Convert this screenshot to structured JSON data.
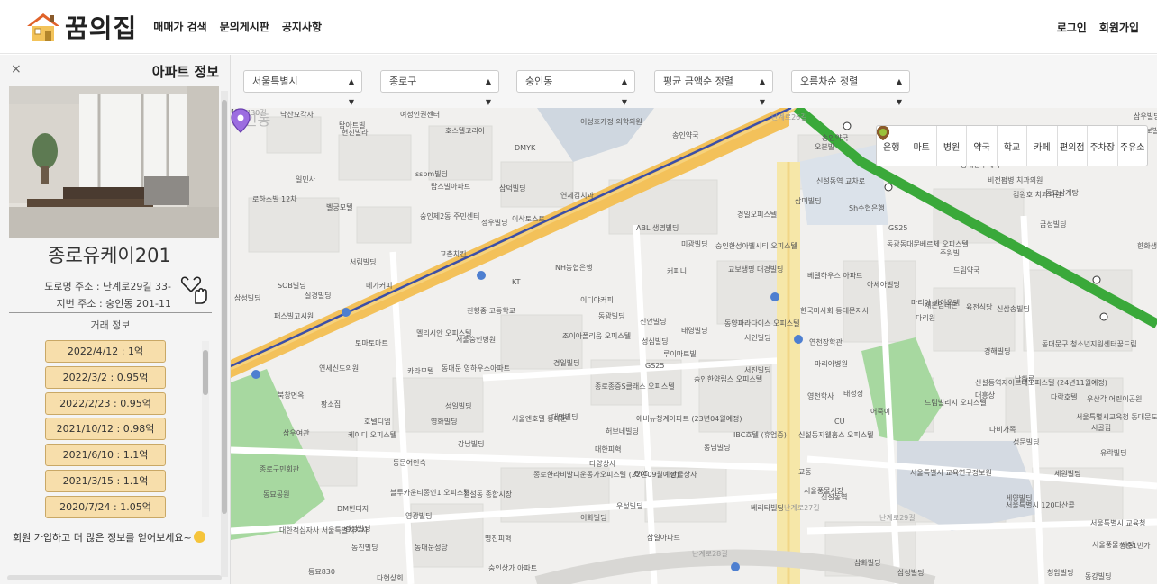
{
  "header": {
    "logo_text": "꿈의집",
    "nav": [
      "매매가 검색",
      "문의게시판",
      "공지사항"
    ],
    "login": "로그인",
    "signup": "회원가입"
  },
  "sidebar": {
    "close": "×",
    "title": "아파트 정보",
    "apt_name": "종로유케이201",
    "road_address": "도로명 주소 : 난계로29길 33-",
    "lot_address": "지번 주소 : 숭인동 201-11",
    "deal_heading": "거래 정보",
    "deals": [
      "2022/4/12 : 1억",
      "2022/3/2 : 0.95억",
      "2022/2/23 : 0.95억",
      "2021/10/12 : 0.98억",
      "2021/6/10 : 1.1억",
      "2021/3/15 : 1.1억",
      "2020/7/24 : 1.05억"
    ],
    "join_message": "회원 가입하고 더 많은 정보를 얻어보세요~"
  },
  "filters": {
    "city": "서울특별시",
    "district": "종로구",
    "dong": "숭인동",
    "sort_price": "평균 금액순 정렬",
    "sort_order": "오름차순 정렬"
  },
  "categories": [
    "은행",
    "마트",
    "병원",
    "약국",
    "학교",
    "카페",
    "편의점",
    "주차장",
    "주유소"
  ],
  "map_labels": [
    {
      "t": "낙산묘각사",
      "c": "poi"
    },
    {
      "t": "여성인권센터",
      "c": "poi"
    },
    {
      "t": "탑아트빌",
      "c": "poi"
    },
    {
      "t": "현진빌라",
      "c": "poi"
    },
    {
      "t": "일민사",
      "c": "poi"
    },
    {
      "t": "로하스빌 12차",
      "c": "poi"
    },
    {
      "t": "이성호가정 의학의원",
      "c": "poi"
    },
    {
      "t": "송인약국",
      "c": "poi"
    },
    {
      "t": "호스텔코리아",
      "c": "poi"
    },
    {
      "t": "DMYK",
      "c": "poi"
    },
    {
      "t": "sspm빌딩",
      "c": "poi"
    },
    {
      "t": "탑스빌아파트",
      "c": "poi"
    },
    {
      "t": "삼덕빌딩",
      "c": "poi"
    },
    {
      "t": "연세김치과",
      "c": "poi"
    },
    {
      "t": "벨궁모텔",
      "c": "poi"
    },
    {
      "t": "숭인제2동 주민센터",
      "c": "poi"
    },
    {
      "t": "정우빌딩",
      "c": "poi"
    },
    {
      "t": "이삭토스트",
      "c": "poi"
    },
    {
      "t": "ABL 생명빌딩",
      "c": "poi"
    },
    {
      "t": "미광빌딩",
      "c": "poi"
    },
    {
      "t": "경일오피스텔",
      "c": "poi"
    },
    {
      "t": "숭인한성아벨시티 오피스텔",
      "c": "poi"
    },
    {
      "t": "교보생명 대경빌딩",
      "c": "poi"
    },
    {
      "t": "서림빌딩",
      "c": "poi"
    },
    {
      "t": "교촌치킨",
      "c": "poi"
    },
    {
      "t": "NH농협은행",
      "c": "poi"
    },
    {
      "t": "커피니",
      "c": "poi"
    },
    {
      "t": "메가커피",
      "c": "poi"
    },
    {
      "t": "SOB빌딩",
      "c": "poi"
    },
    {
      "t": "삼성빌딩",
      "c": "poi"
    },
    {
      "t": "실경빌딩",
      "c": "poi"
    },
    {
      "t": "패스빌고시원",
      "c": "poi"
    },
    {
      "t": "KT",
      "c": "poi"
    },
    {
      "t": "이디야커피",
      "c": "poi"
    },
    {
      "t": "친형중 고등학교",
      "c": "poi"
    },
    {
      "t": "동광빌딩",
      "c": "poi"
    },
    {
      "t": "신안빌딩",
      "c": "poi"
    },
    {
      "t": "태영빌딩",
      "c": "poi"
    },
    {
      "t": "동양파라다이스 오피스텔",
      "c": "poi"
    },
    {
      "t": "멜리시안 오피스텔",
      "c": "poi"
    },
    {
      "t": "서울숭인병원",
      "c": "poi"
    },
    {
      "t": "토마토마트",
      "c": "poi"
    },
    {
      "t": "조이아폴리움 오피스텔",
      "c": "poi"
    },
    {
      "t": "성심빌딩",
      "c": "poi"
    },
    {
      "t": "루이마트빌",
      "c": "poi"
    },
    {
      "t": "GS25",
      "c": "poi"
    },
    {
      "t": "경일빌딩",
      "c": "poi"
    },
    {
      "t": "서인빌딩",
      "c": "poi"
    },
    {
      "t": "서진빌딩",
      "c": "poi"
    },
    {
      "t": "연세신도의원",
      "c": "poi"
    },
    {
      "t": "카라모텔",
      "c": "poi"
    },
    {
      "t": "동대문 영하우스아파트",
      "c": "poi"
    },
    {
      "t": "숭인한양립스 오피스텔",
      "c": "poi"
    },
    {
      "t": "종로종증S클래스 오피스텔",
      "c": "poi"
    },
    {
      "t": "북창면옥",
      "c": "poi"
    },
    {
      "t": "황소집",
      "c": "poi"
    },
    {
      "t": "성일빌딩",
      "c": "poi"
    },
    {
      "t": "호텔디엠",
      "c": "poi"
    },
    {
      "t": "영화빌딩",
      "c": "poi"
    },
    {
      "t": "서울엔호텔 동대문",
      "c": "poi"
    },
    {
      "t": "대명빌딩",
      "c": "poi"
    },
    {
      "t": "에비뉴청계아파트 (23년04월예정)",
      "c": "poi"
    },
    {
      "t": "허브네빌딩",
      "c": "poi"
    },
    {
      "t": "삼우여관",
      "c": "poi"
    },
    {
      "t": "케이디 오피스텔",
      "c": "poi"
    },
    {
      "t": "강남빌딩",
      "c": "poi"
    },
    {
      "t": "대한피혁",
      "c": "poi"
    },
    {
      "t": "IBC호텔 (휴업중)",
      "c": "poi"
    },
    {
      "t": "신설동지웰홈스 오피스텔",
      "c": "poi"
    },
    {
      "t": "동문여인숙",
      "c": "poi"
    },
    {
      "t": "다양상사",
      "c": "poi"
    },
    {
      "t": "종로구민회관",
      "c": "poi"
    },
    {
      "t": "만물상사",
      "c": "poi"
    },
    {
      "t": "종로한라비발디운동가오피스텔 (22년09월예정)",
      "c": "poi"
    },
    {
      "t": "BYC",
      "c": "poi"
    },
    {
      "t": "동묘공원",
      "c": "poi"
    },
    {
      "t": "블루카운티종인1 오피스텔",
      "c": "poi"
    },
    {
      "t": "신설동 종합시장",
      "c": "poi"
    },
    {
      "t": "우성빌딩",
      "c": "poi"
    },
    {
      "t": "DM빈티지",
      "c": "poi"
    },
    {
      "t": "영광빌딩",
      "c": "poi"
    },
    {
      "t": "이화빌딩",
      "c": "poi"
    },
    {
      "t": "베리타빌딩",
      "c": "poi"
    },
    {
      "t": "대한적십자사 서울특별시지사",
      "c": "poi"
    },
    {
      "t": "경성빌딩",
      "c": "poi"
    },
    {
      "t": "명진피혁",
      "c": "poi"
    },
    {
      "t": "동진빌딩",
      "c": "poi"
    },
    {
      "t": "동대문성당",
      "c": "poi"
    },
    {
      "t": "삼일아파트",
      "c": "poi"
    },
    {
      "t": "동묘830",
      "c": "poi"
    },
    {
      "t": "다현상회",
      "c": "poi"
    },
    {
      "t": "숭인상가 아파트",
      "c": "poi"
    },
    {
      "t": "송인약국",
      "c": "poi"
    },
    {
      "t": "오븐빌",
      "c": "poi"
    },
    {
      "t": "신설동역 교차로",
      "c": "poi"
    },
    {
      "t": "삼미빌딩",
      "c": "poi"
    },
    {
      "t": "Sh수협은행",
      "c": "poi"
    },
    {
      "t": "동대문우체국",
      "c": "poi"
    },
    {
      "t": "비전펌병 치과의원",
      "c": "poi"
    },
    {
      "t": "김원호 치과의원",
      "c": "poi"
    },
    {
      "t": "동묘삼계탕",
      "c": "poi"
    },
    {
      "t": "금성빌딩",
      "c": "poi"
    },
    {
      "t": "한화생명보험 신설동지점",
      "c": "poi"
    },
    {
      "t": "GS25",
      "c": "poi"
    },
    {
      "t": "동광동대문베르체 오피스텔",
      "c": "poi"
    },
    {
      "t": "주원빌",
      "c": "poi"
    },
    {
      "t": "드림약국",
      "c": "poi"
    },
    {
      "t": "베델하우스 아파트",
      "c": "poi"
    },
    {
      "t": "아세아빌딩",
      "c": "poi"
    },
    {
      "t": "마리아 바이오텍",
      "c": "poi"
    },
    {
      "t": "한국마사회 동대문지사",
      "c": "poi"
    },
    {
      "t": "세본임레본",
      "c": "poi"
    },
    {
      "t": "육전식당",
      "c": "poi"
    },
    {
      "t": "신삼송빌딩",
      "c": "poi"
    },
    {
      "t": "다리원",
      "c": "poi"
    },
    {
      "t": "연천장학관",
      "c": "poi"
    },
    {
      "t": "마리아병원",
      "c": "poi"
    },
    {
      "t": "동대문구 청소년지원센터꿈드림",
      "c": "poi"
    },
    {
      "t": "경해빌딩",
      "c": "poi"
    },
    {
      "t": "남화루",
      "c": "poi"
    },
    {
      "t": "신설동역자이르네오피스텔 (24년11월예정)",
      "c": "poi"
    },
    {
      "t": "대흥상",
      "c": "poi"
    },
    {
      "t": "태성정",
      "c": "poi"
    },
    {
      "t": "영천학사",
      "c": "poi"
    },
    {
      "t": "CU",
      "c": "poi"
    },
    {
      "t": "어죽이",
      "c": "poi"
    },
    {
      "t": "드림빌리지 오피스텔",
      "c": "poi"
    },
    {
      "t": "다락호텔",
      "c": "poi"
    },
    {
      "t": "우산각 어린이공원",
      "c": "poi"
    },
    {
      "t": "서울특별시교육청 동대문도서관",
      "c": "poi"
    },
    {
      "t": "시골집",
      "c": "poi"
    },
    {
      "t": "다비가족",
      "c": "poi"
    },
    {
      "t": "성문빌딩",
      "c": "poi"
    },
    {
      "t": "유락빌딩",
      "c": "poi"
    },
    {
      "t": "서울풍물시장",
      "c": "poi"
    },
    {
      "t": "서울특별시 교육연구정보원",
      "c": "poi"
    },
    {
      "t": "세원빌딩",
      "c": "poi"
    },
    {
      "t": "세양빌딩",
      "c": "poi"
    },
    {
      "t": "서울특별시 120다산콜",
      "c": "poi"
    },
    {
      "t": "서울특별시 교육청",
      "c": "poi"
    },
    {
      "t": "서울풍물 시장",
      "c": "poi"
    },
    {
      "t": "청춘1번가",
      "c": "poi"
    },
    {
      "t": "삼화빌딩",
      "c": "poi"
    },
    {
      "t": "삼성빌딩",
      "c": "poi"
    },
    {
      "t": "청암빌딩",
      "c": "poi"
    },
    {
      "t": "동강빌딩",
      "c": "poi"
    },
    {
      "t": "삼우빌딩",
      "c": "poi"
    },
    {
      "t": "동보빌딩",
      "c": "poi"
    },
    {
      "t": "동님빌딩",
      "c": "poi"
    },
    {
      "t": "교동",
      "c": "poi"
    },
    {
      "t": "신설동역",
      "c": "poi"
    },
    {
      "t": "난계로27길",
      "c": "road"
    },
    {
      "t": "난계로29길",
      "c": "road"
    },
    {
      "t": "난계로26길",
      "c": "road"
    },
    {
      "t": "난계로28길",
      "c": "road"
    },
    {
      "t": "난계로30길",
      "c": "road"
    },
    {
      "t": "난계로",
      "c": "road"
    },
    {
      "t": "숭인동",
      "c": "area"
    },
    {
      "t": "11",
      "c": "poi"
    }
  ]
}
